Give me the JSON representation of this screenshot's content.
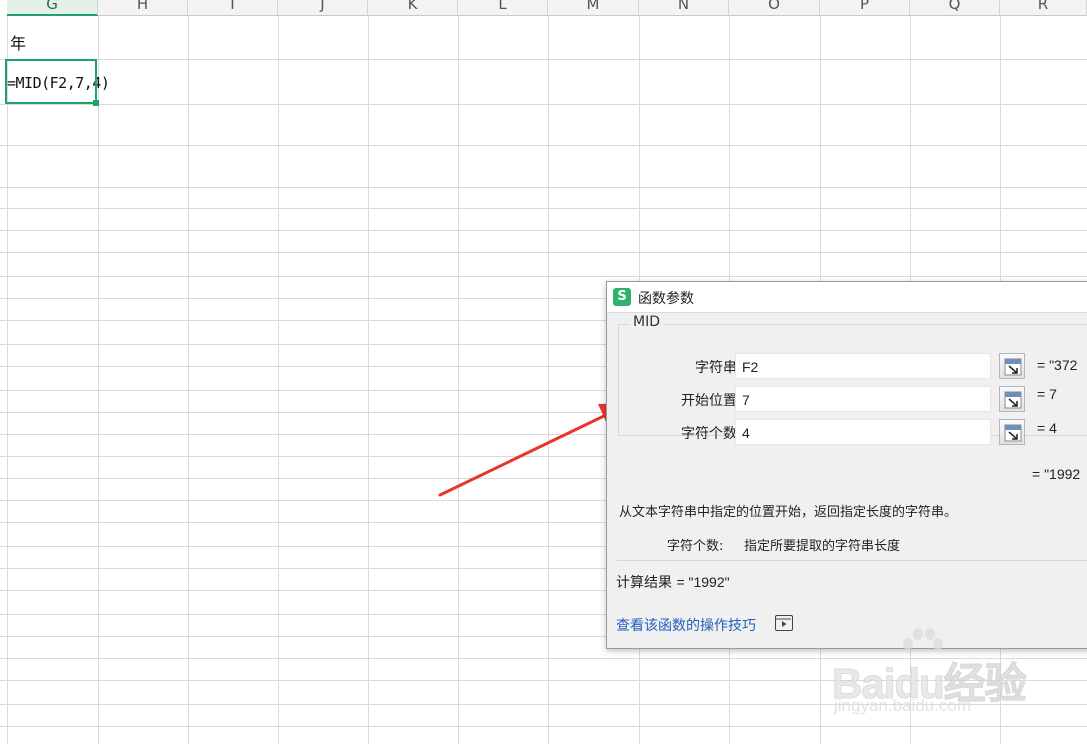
{
  "sheet": {
    "columns": [
      "G",
      "H",
      "I",
      "J",
      "K",
      "L",
      "M",
      "N",
      "O",
      "P",
      "Q",
      "R"
    ],
    "active_column": "G",
    "cells": {
      "g2": "年",
      "g3": "=MID(F2,7,4)"
    }
  },
  "dialog": {
    "title": "函数参数",
    "app_icon_letter": "S",
    "function_name": "MID",
    "args": [
      {
        "label": "字符串",
        "value": "F2",
        "result": "= \"372"
      },
      {
        "label": "开始位置",
        "value": "7",
        "result": "= 7"
      },
      {
        "label": "字符个数",
        "value": "4",
        "result": "= 4"
      }
    ],
    "overall_result": "= \"1992",
    "description": "从文本字符串中指定的位置开始，返回指定长度的字符串。",
    "arg_description_label": "字符个数:",
    "arg_description": "指定所要提取的字符串长度",
    "calc_result_label": "计算结果",
    "calc_result_value": "=  \"1992\"",
    "help_link": "查看该函数的操作技巧"
  },
  "watermark": {
    "brand": "Baidu经验",
    "url": "jingyan.baidu.com"
  },
  "colors": {
    "accent_green": "#21a366",
    "arrow_red": "#e8352b",
    "link_blue": "#1f5fbf"
  }
}
